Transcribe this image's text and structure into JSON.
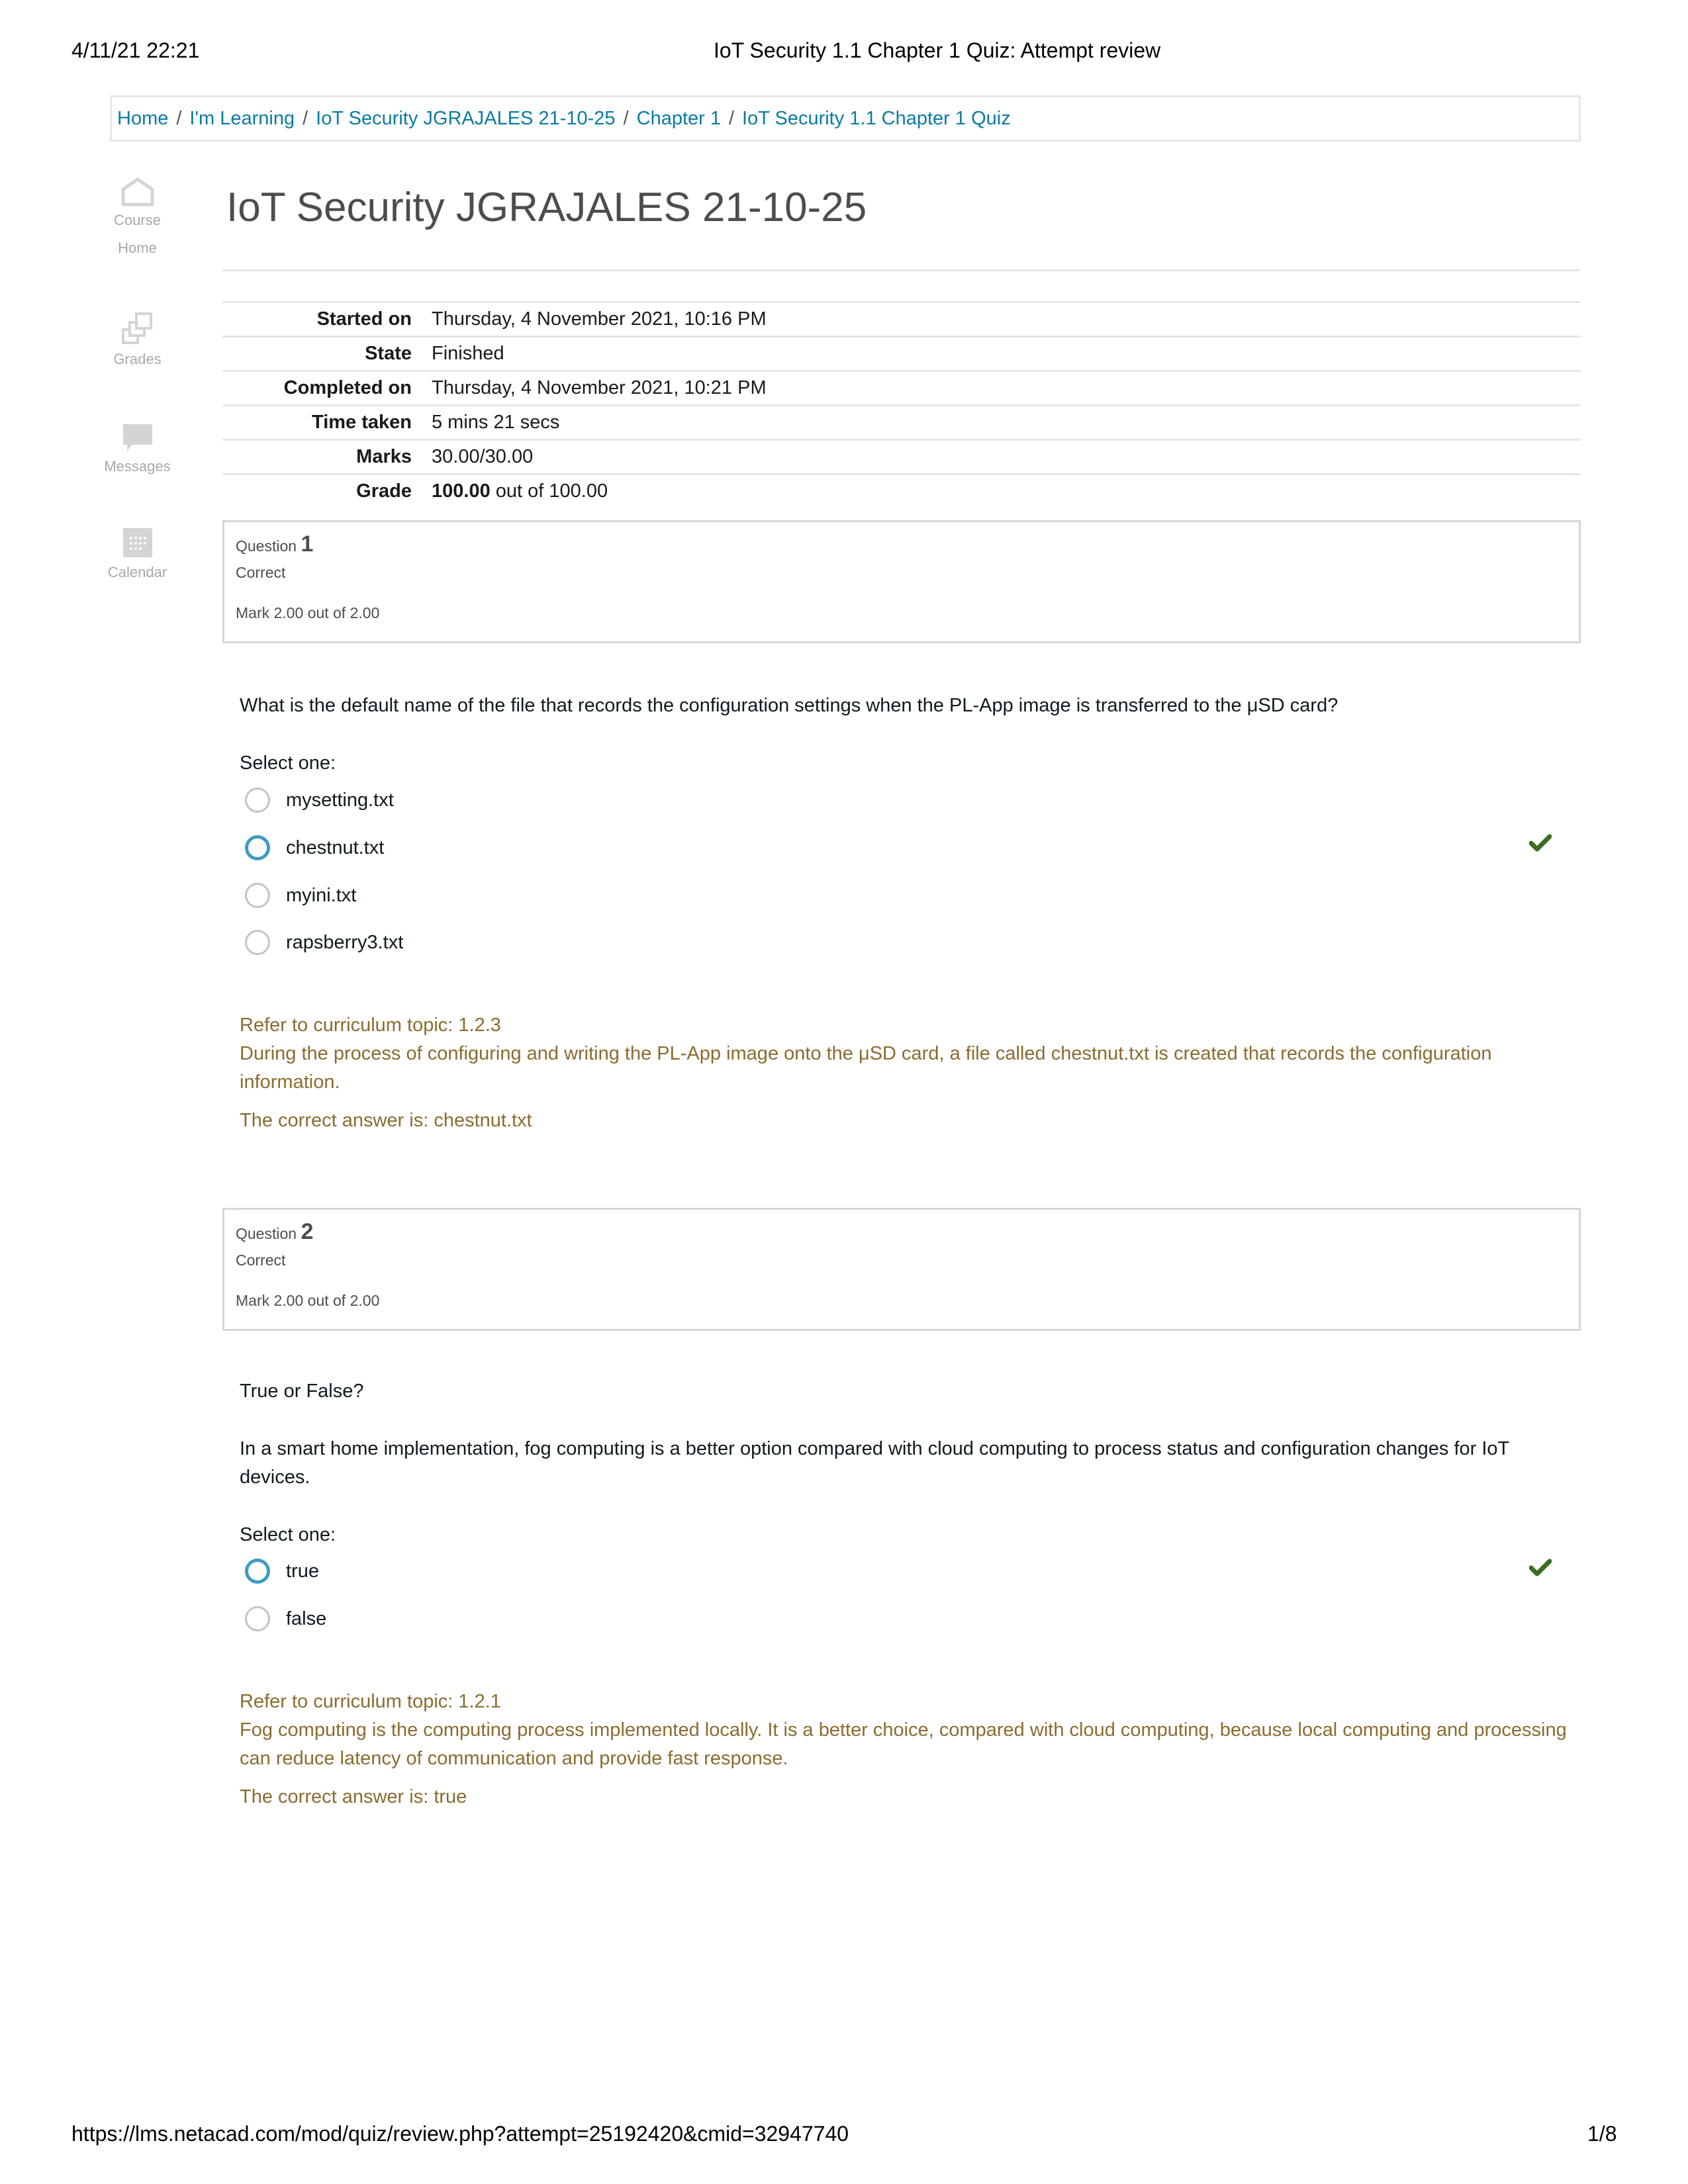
{
  "print_header": {
    "datetime": "4/11/21 22:21",
    "title": "IoT Security 1.1 Chapter 1 Quiz: Attempt review"
  },
  "breadcrumb": [
    {
      "label": "Home"
    },
    {
      "label": "I'm Learning"
    },
    {
      "label": "IoT Security JGRAJALES 21-10-25"
    },
    {
      "label": "Chapter 1"
    },
    {
      "label": "IoT Security 1.1 Chapter 1 Quiz"
    }
  ],
  "sidenav": {
    "items": [
      {
        "label_line1": "Course",
        "label_line2": "Home",
        "icon": "home-icon"
      },
      {
        "label_line1": "Grades",
        "icon": "grades-icon"
      },
      {
        "label_line1": "Messages",
        "icon": "messages-icon"
      },
      {
        "label_line1": "Calendar",
        "icon": "calendar-icon"
      }
    ]
  },
  "page_title": "IoT Security JGRAJALES 21-10-25",
  "summary": [
    {
      "key": "Started on",
      "value": "Thursday, 4 November 2021, 10:16 PM"
    },
    {
      "key": "State",
      "value": "Finished"
    },
    {
      "key": "Completed on",
      "value": "Thursday, 4 November 2021, 10:21 PM"
    },
    {
      "key": "Time taken",
      "value": "5 mins 21 secs"
    },
    {
      "key": "Marks",
      "value": "30.00/30.00"
    },
    {
      "key": "Grade",
      "value_bold": "100.00",
      "value_rest": " out of 100.00"
    }
  ],
  "questions": [
    {
      "label": "Question",
      "number": "1",
      "state": "Correct",
      "mark": "Mark 2.00 out of 2.00",
      "text": "What is the default name of the file that records the configuration settings when the PL-App image is transferred to the μSD card?",
      "select_prompt": "Select one:",
      "options": [
        {
          "label": "mysetting.txt",
          "selected": false
        },
        {
          "label": "chestnut.txt",
          "selected": true
        },
        {
          "label": "myini.txt",
          "selected": false
        },
        {
          "label": "rapsberry3.txt",
          "selected": false
        }
      ],
      "feedback_topic": "Refer to curriculum topic: 1.2.3",
      "feedback_text": "During the process of configuring and writing the PL-App image onto the μSD card, a file called chestnut.txt is created that records the configuration information.",
      "correct_answer": "The correct answer is: chestnut.txt"
    },
    {
      "label": "Question",
      "number": "2",
      "state": "Correct",
      "mark": "Mark 2.00 out of 2.00",
      "intro": "True or False?",
      "text": "In a smart home implementation, fog computing is a better option compared with cloud computing to process status and configuration changes for IoT devices.",
      "select_prompt": "Select one:",
      "options": [
        {
          "label": "true",
          "selected": true
        },
        {
          "label": "false",
          "selected": false
        }
      ],
      "feedback_topic": "Refer to curriculum topic: 1.2.1",
      "feedback_text": "Fog computing is the computing process implemented locally. It is a better choice, compared with cloud computing, because local computing and processing can reduce latency of communication and provide fast response.",
      "correct_answer": "The correct answer is: true"
    }
  ],
  "colors": {
    "link": "#0a7ba3",
    "feedback": "#8b6b2f",
    "correct_check": "#3b6e22",
    "selected_radio": "#3d9cc4"
  },
  "print_footer": {
    "url": "https://lms.netacad.com/mod/quiz/review.php?attempt=25192420&cmid=32947740",
    "page": "1/8"
  }
}
